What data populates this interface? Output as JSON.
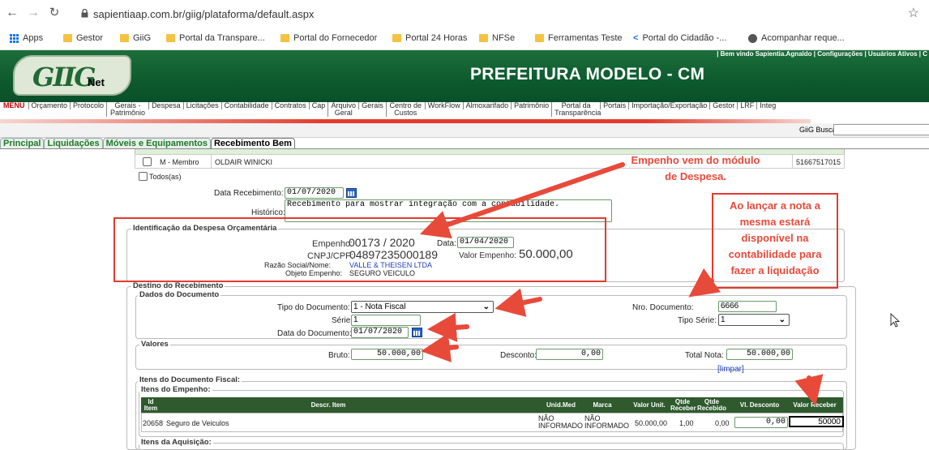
{
  "browser": {
    "url": "sapientiaap.com.br/giig/plataforma/default.aspx",
    "bookmarks": [
      "Apps",
      "Gestor",
      "GiiG",
      "Portal da Transpare...",
      "Portal do Fornecedor",
      "Portal 24 Horas",
      "NFSe",
      "Ferramentas Teste",
      "Portal do Cidadão -...",
      "Acompanhar reque..."
    ]
  },
  "header": {
    "topbar": "| Bem vindo Sapientia.Agnaldo   |  Configurações   |  Usuários Ativos   |  C",
    "logo_main": "GIIG",
    "logo_sub": "Net",
    "title": "PREFEITURA MODELO - CM"
  },
  "menu": {
    "items": [
      "MENU",
      "Orçamento",
      "Protocolo",
      "Gerais - Patrimônio",
      "Despesa",
      "Licitações",
      "Contabilidade",
      "Contratos",
      "Cap",
      "Arquivo Geral",
      "Gerais",
      "Centro de Custos",
      "WorkFlow",
      "Almoxarifado",
      "Patrimônio",
      "Portal da Transparência",
      "Portais",
      "Importação/Exportação",
      "Gestor",
      "LRF",
      "Integ"
    ]
  },
  "search": {
    "label": "GiiG Busca:"
  },
  "tabs": [
    "Principal",
    "Liquidações",
    "Móveis e Equipamentos",
    "Recebimento Bem"
  ],
  "members": {
    "row_role": "M - Membro",
    "row_name": "OLDAIR WINICKI",
    "row_id": "51667517015",
    "todos": "Todos(as)"
  },
  "receipt": {
    "data_label": "Data Recebimento:",
    "data_value": "01/07/2020",
    "historico_label": "Histórico:",
    "historico_value": "Recebimento para mostrar integração com a contabilidade."
  },
  "despesa": {
    "legend": "Identificação da Despesa Orçamentária",
    "empenho_label": "Empenho:",
    "empenho_value": "00173 / 2020",
    "data_label": "Data:",
    "data_value": "01/04/2020",
    "cnpj_label": "CNPJ/CPF:",
    "cnpj_value": "04897235000189",
    "valor_label": "Valor Empenho:",
    "valor_value": "50.000,00",
    "razao_label": "Razão Social/Nome:",
    "razao_value": "VALLE & THEISEN LTDA",
    "objeto_label": "Objeto Empenho:",
    "objeto_value": "SEGURO VEICULO"
  },
  "destino": {
    "legend": "Destino do Recebimento",
    "dados_legend": "Dados do Documento",
    "tipo_label": "Tipo do Documento:",
    "tipo_value": "1 - Nota Fiscal",
    "nro_label": "Nro. Documento:",
    "nro_value": "6666",
    "serie_label": "Série:",
    "serie_value": "1",
    "tipo_serie_label": "Tipo Série:",
    "tipo_serie_value": "1",
    "data_doc_label": "Data do Documento:",
    "data_doc_value": "01/07/2020"
  },
  "valores": {
    "legend": "Valores",
    "bruto_label": "Bruto:",
    "bruto_value": "50.000,00",
    "desconto_label": "Desconto:",
    "desconto_value": "0,00",
    "total_label": "Total Nota:",
    "total_value": "50.000,00",
    "limpar": "[limpar]"
  },
  "itens": {
    "fiscal_legend": "Itens do Documento Fiscal:",
    "empenho_legend": "Itens do Empenho:",
    "aquisicao_legend": "Itens da Aquisição:",
    "headers": [
      "Id Item",
      "Descr. Item",
      "Unid.Med",
      "Marca",
      "Valor Unit.",
      "Qtde Receber",
      "Qtde Recebido",
      "Vl. Desconto",
      "Valor Receber"
    ],
    "row": {
      "id": "20658",
      "descr": "Seguro de Veiculos",
      "unid": "NÃO INFORMADO",
      "marca": "NÃO INFORMADO",
      "valor_unit": "50.000,00",
      "qtde_receber": "1,00",
      "qtde_recebido": "0,00",
      "desconto": "0,00",
      "valor_receber": "50000"
    }
  },
  "annotations": {
    "top": "Empenho vem do módulo de Despesa.",
    "side": "Ao lançar a nota a mesma estará disponível na contabilidade para fazer a liquidação"
  },
  "colors": {
    "header_green": "#0d5a2e",
    "annot_red": "#e84a3a",
    "link_blue": "#1a3fbf"
  }
}
